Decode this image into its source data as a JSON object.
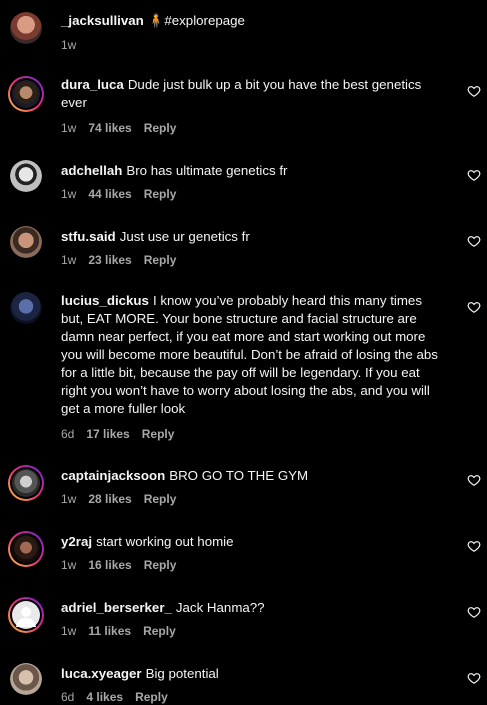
{
  "caption": {
    "username": "_jacksullivan",
    "emoji": "🧍",
    "text": "#explorepage",
    "time": "1w"
  },
  "labels": {
    "reply": "Reply"
  },
  "comments": [
    {
      "username": "dura_luca",
      "text": "Dude just bulk up a bit you have the best genetics ever",
      "time": "1w",
      "likes": "74 likes"
    },
    {
      "username": "adchellah",
      "text": "Bro has ultimate genetics fr",
      "time": "1w",
      "likes": "44 likes"
    },
    {
      "username": "stfu.said",
      "text": "Just use ur genetics fr",
      "time": "1w",
      "likes": "23 likes"
    },
    {
      "username": "lucius_dickus",
      "text": "I know you’ve probably heard this many times but, EAT MORE. Your bone structure and facial structure are damn near perfect, if you eat more and start working out more you will become more beautiful. Don’t be afraid of losing the abs for a little bit, because the pay off will be legendary. If you eat right you won’t have to worry about losing the abs, and you will get a more fuller look",
      "time": "6d",
      "likes": "17 likes"
    },
    {
      "username": "captainjacksoon",
      "text": "BRO GO TO THE GYM",
      "time": "1w",
      "likes": "28 likes"
    },
    {
      "username": "y2raj",
      "text": "start working out homie",
      "time": "1w",
      "likes": "16 likes"
    },
    {
      "username": "adriel_berserker_",
      "text": "Jack Hanma??",
      "time": "1w",
      "likes": "11 likes"
    },
    {
      "username": "luca.xyeager",
      "text": "Big potential",
      "time": "6d",
      "likes": "4 likes"
    }
  ],
  "colors": {
    "background": "#000000",
    "text": "#f5f5f5",
    "muted": "#a8a8a8",
    "story_ring": [
      "#f9ce34",
      "#ee2a7b",
      "#6228d7"
    ]
  },
  "icons": {
    "like": "heart-outline-icon"
  }
}
